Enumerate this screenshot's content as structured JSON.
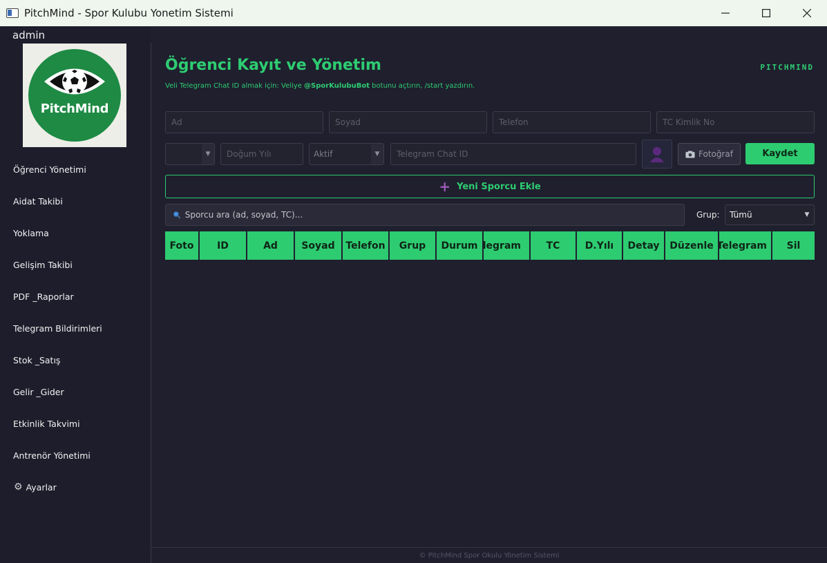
{
  "window": {
    "title": "PitchMind - Spor Kulubu Yonetim Sistemi",
    "minimize_icon": "minimize-icon",
    "maximize_icon": "maximize-icon",
    "close_icon": "close-icon",
    "titlebar_color": "#eef6ee"
  },
  "sidebar": {
    "user": "admin",
    "logo_text": "PitchMind",
    "logo_color": "#1e8a44",
    "items": [
      {
        "label": "Öğrenci Yönetimi"
      },
      {
        "label": "Aidat Takibi"
      },
      {
        "label": "Yoklama"
      },
      {
        "label": "Gelişim Takibi"
      },
      {
        "label": "PDF _Raporlar"
      },
      {
        "label": "Telegram Bildirimleri"
      },
      {
        "label": "Stok _Satış"
      },
      {
        "label": "Gelir _Gider"
      },
      {
        "label": "Etkinlik Takvimi"
      },
      {
        "label": "Antrenör Yönetimi"
      },
      {
        "label": "Ayarlar",
        "icon": "gear-icon"
      }
    ]
  },
  "header": {
    "title": "Öğrenci Kayıt ve Yönetim",
    "brand": "PITCHMIND",
    "hint_prefix": "Veli Telegram Chat ID almak için: Veliye ",
    "hint_bot": "@SporKulubuBot",
    "hint_suffix": " botunu açtırın, /start yazdırın."
  },
  "form": {
    "ad_placeholder": "Ad",
    "soyad_placeholder": "Soyad",
    "telefon_placeholder": "Telefon",
    "tc_placeholder": "TC Kimlik No",
    "group_value": "",
    "dogum_placeholder": "Doğum Yılı",
    "status_value": "Aktif",
    "telegram_placeholder": "Telegram Chat ID",
    "avatar_icon": "user-silhouette-icon",
    "photo_label": "Fotoğraf",
    "photo_icon": "camera-icon",
    "save_label": "Kaydet"
  },
  "actions": {
    "add_label": "Yeni Sporcu Ekle",
    "add_icon": "plus-icon"
  },
  "filter": {
    "search_placeholder": "Sporcu ara (ad, soyad, TC)...",
    "search_icon": "search-icon",
    "group_label": "Grup:",
    "group_value": "Tümü"
  },
  "table": {
    "columns": [
      "Foto",
      "ID",
      "Ad",
      "Soyad",
      "Telefon",
      "Grup",
      "Durum",
      "Telegram",
      "TC",
      "D.Yılı",
      "Detay",
      "Düzenle",
      "Telegram",
      "Sil"
    ],
    "header_color": "#2ecc71",
    "rows": []
  },
  "footer": {
    "text": "© PitchMind Spor Okulu Yönetim Sistemi"
  },
  "colors": {
    "accent": "#2ecc71",
    "background": "#1f1f2e",
    "plus": "#9b59b6"
  }
}
